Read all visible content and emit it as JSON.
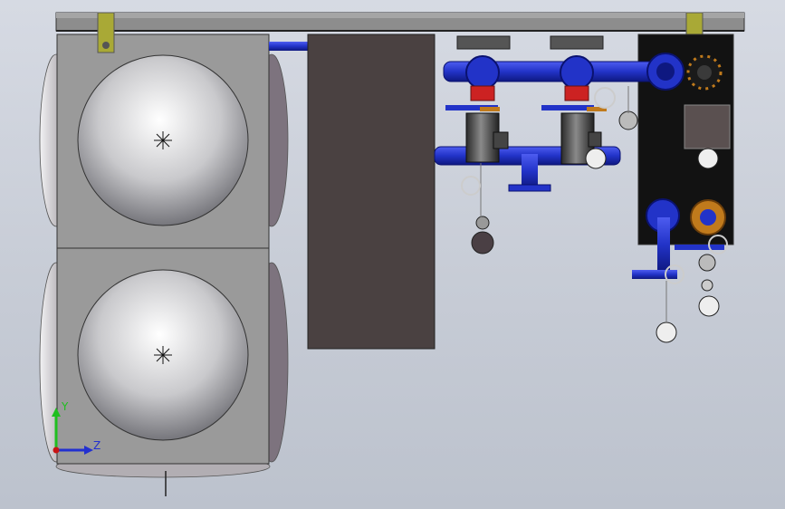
{
  "viewport": {
    "background_top": "#d6dae3",
    "background_bottom": "#bcc2cd"
  },
  "triad": {
    "axis_y_label": "Y",
    "axis_z_label": "Z",
    "axis_y_color": "#1fbf1f",
    "axis_z_color": "#2230d0",
    "origin_color": "#c81414"
  },
  "colors": {
    "frame": "#8d8d8d",
    "mounting_bracket": "#a9a936",
    "water_tank_panel": "#9a9a9a",
    "control_cabinet": "#4a4141",
    "pipe": "#2233c8",
    "pump_motor": "#3e3e3e",
    "panel_board": "#121212",
    "flange_bronze": "#c07a1c"
  },
  "model": {
    "parts": [
      "support-frame",
      "water-tank",
      "control-cabinet",
      "pump-unit-1",
      "pump-unit-2",
      "discharge-manifold",
      "suction-manifold",
      "valve-panel",
      "pressure-gauges"
    ]
  }
}
